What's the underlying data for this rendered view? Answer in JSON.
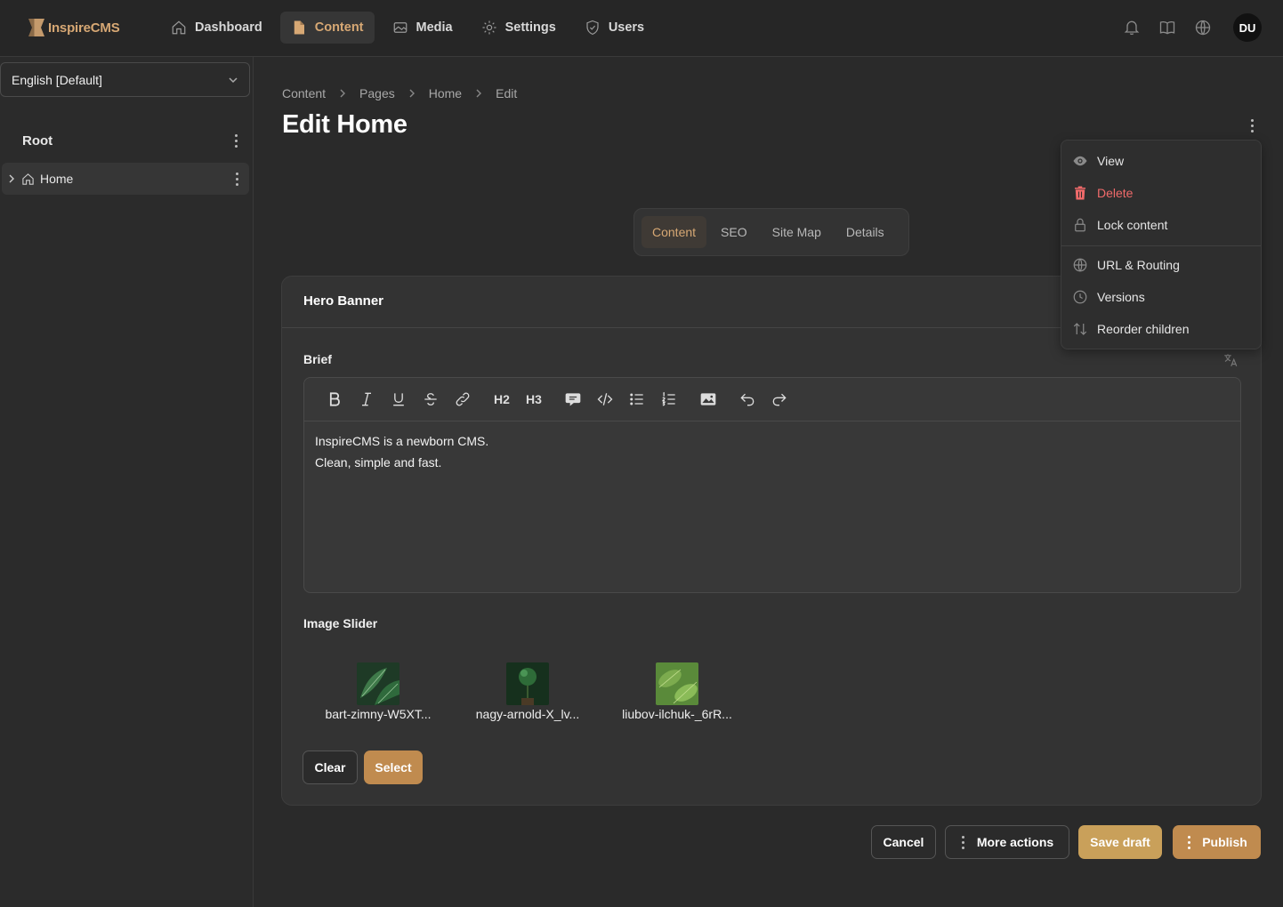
{
  "app": {
    "logo_text": "InspireCMS"
  },
  "nav": [
    {
      "label": "Dashboard",
      "icon": "home-icon"
    },
    {
      "label": "Content",
      "icon": "document-icon",
      "active": true
    },
    {
      "label": "Media",
      "icon": "image-icon"
    },
    {
      "label": "Settings",
      "icon": "gear-icon"
    },
    {
      "label": "Users",
      "icon": "shield-icon"
    }
  ],
  "user": {
    "initials": "DU"
  },
  "sidebar": {
    "language": "English [Default]",
    "root_label": "Root",
    "tree": [
      {
        "label": "Home"
      }
    ]
  },
  "breadcrumb": [
    "Content",
    "Pages",
    "Home",
    "Edit"
  ],
  "page_title": "Edit Home",
  "tabs": [
    "Content",
    "SEO",
    "Site Map",
    "Details"
  ],
  "card": {
    "title": "Hero Banner",
    "brief_label": "Brief",
    "toolbar": {
      "h2": "H2",
      "h3": "H3"
    },
    "brief_lines": [
      "InspireCMS is a newborn CMS.",
      "Clean, simple and fast."
    ],
    "slider_label": "Image Slider",
    "slides": [
      "bart-zimny-W5XT...",
      "nagy-arnold-X_lv...",
      "liubov-ilchuk-_6rR..."
    ],
    "clear_label": "Clear",
    "select_label": "Select"
  },
  "footer": {
    "cancel": "Cancel",
    "more_actions": "More actions",
    "save_draft": "Save draft",
    "publish": "Publish"
  },
  "dropdown": {
    "view": "View",
    "delete": "Delete",
    "lock": "Lock content",
    "url_routing": "URL & Routing",
    "versions": "Versions",
    "reorder": "Reorder children"
  },
  "colors": {
    "accent": "#d7a874",
    "danger": "#f06a6a",
    "button_gold": "#c08b4f"
  }
}
